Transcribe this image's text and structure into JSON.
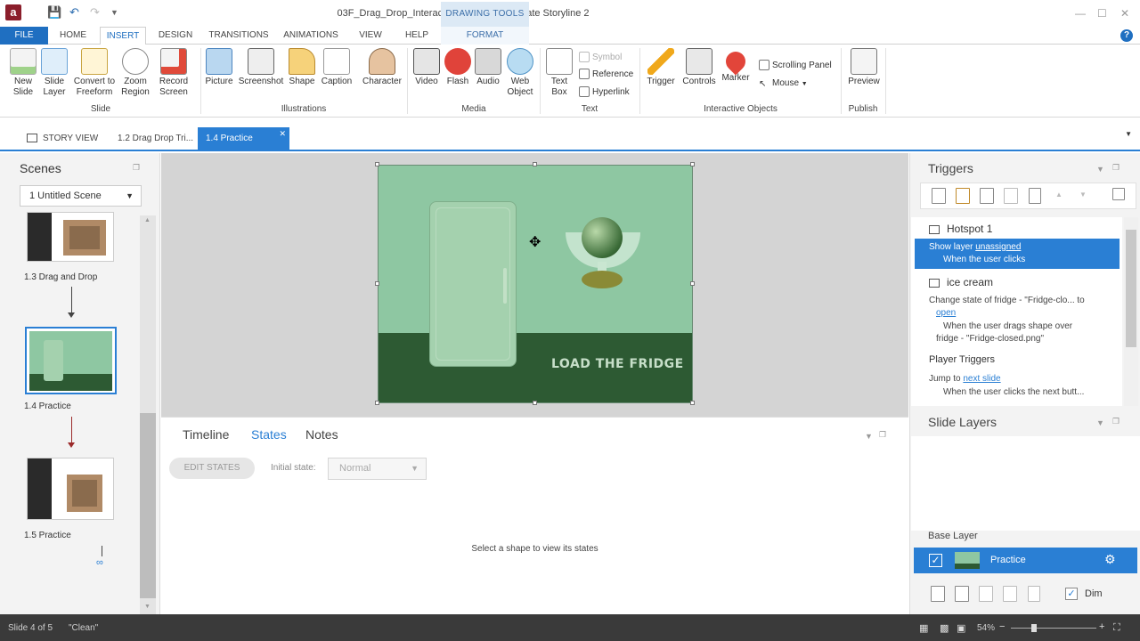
{
  "app": {
    "logo": "a",
    "window_title": "03F_Drag_Drop_Interactions.story* - Articulate Storyline 2",
    "contextual_group": "DRAWING TOOLS"
  },
  "ribbon_tabs": {
    "file": "FILE",
    "home": "HOME",
    "insert": "INSERT",
    "design": "DESIGN",
    "transitions": "TRANSITIONS",
    "animations": "ANIMATIONS",
    "view": "VIEW",
    "help": "HELP",
    "format": "FORMAT"
  },
  "ribbon": {
    "new_slide": [
      "New",
      "Slide"
    ],
    "slide_layer": [
      "Slide",
      "Layer"
    ],
    "convert": [
      "Convert to",
      "Freeform"
    ],
    "zoom_region": [
      "Zoom",
      "Region"
    ],
    "record_screen": [
      "Record",
      "Screen"
    ],
    "group_slide": "Slide",
    "picture": "Picture",
    "screenshot": "Screenshot",
    "shape": "Shape",
    "caption": "Caption",
    "character": "Character",
    "group_illustrations": "Illustrations",
    "video": "Video",
    "flash": "Flash",
    "audio": "Audio",
    "web_object": [
      "Web",
      "Object"
    ],
    "group_media": "Media",
    "text_box": [
      "Text",
      "Box"
    ],
    "symbol": "Symbol",
    "reference": "Reference",
    "hyperlink": "Hyperlink",
    "group_text": "Text",
    "trigger": "Trigger",
    "controls": "Controls",
    "marker": "Marker",
    "scrolling_panel": "Scrolling Panel",
    "mouse": "Mouse",
    "group_interactive": "Interactive Objects",
    "preview": "Preview",
    "group_publish": "Publish"
  },
  "doc_tabs": {
    "story_view": "STORY VIEW",
    "tab2": "1.2 Drag Drop Tri...",
    "tab3": "1.4 Practice"
  },
  "scenes": {
    "title": "Scenes",
    "selected_scene": "1 Untitled Scene",
    "slides": [
      {
        "label": "1.3 Drag and Drop"
      },
      {
        "label": "1.4 Practice"
      },
      {
        "label": "1.5 Practice"
      }
    ]
  },
  "slide": {
    "title": "LOAD THE FRIDGE"
  },
  "bottom_panel": {
    "tabs": {
      "timeline": "Timeline",
      "states": "States",
      "notes": "Notes"
    },
    "edit_states": "EDIT STATES",
    "initial_state_label": "Initial state:",
    "initial_state_value": "Normal",
    "empty_message": "Select a shape to view its states"
  },
  "triggers": {
    "title": "Triggers",
    "obj1": "Hotspot 1",
    "t1_action": "Show layer ",
    "t1_link": "unassigned",
    "t1_when": "When the user clicks",
    "obj2": "ice cream",
    "t2_action": "Change state of fridge - \"Fridge-clo... to",
    "t2_link": "open",
    "t2_when1": "When the user drags shape over",
    "t2_when2": "fridge - \"Fridge-closed.png\"",
    "player_triggers": "Player Triggers",
    "t3_action": "Jump to ",
    "t3_link": "next slide",
    "t3_when": "When the user clicks the next butt..."
  },
  "slide_layers": {
    "title": "Slide Layers",
    "base_layer_label": "Base Layer",
    "base_layer_name": "Practice",
    "dim": "Dim"
  },
  "status": {
    "slide_info": "Slide 4 of 5",
    "theme": "\"Clean\"",
    "zoom": "54%"
  }
}
